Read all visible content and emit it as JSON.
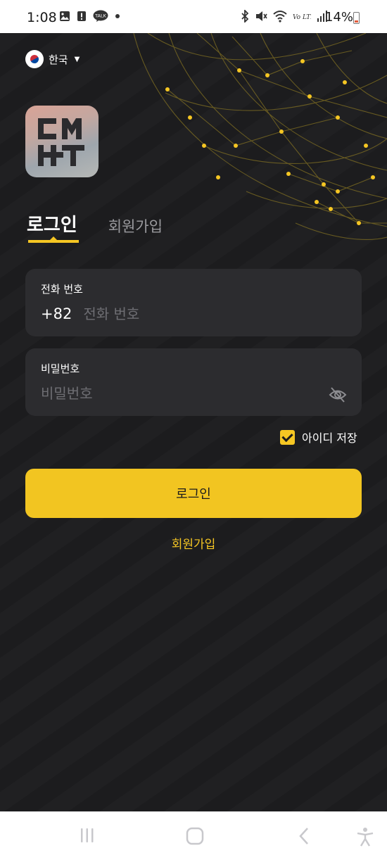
{
  "status_bar": {
    "time": "1:08",
    "battery": "14%",
    "notification_icons": [
      "image-icon",
      "alert-icon",
      "talk-icon",
      "dot-icon"
    ],
    "system_icons": [
      "bluetooth-icon",
      "mute-icon",
      "wifi-icon",
      "volte-icon",
      "signal-icon",
      "battery-icon"
    ],
    "talk_badge": "TALK",
    "volte_label": "Vo LTE"
  },
  "language": {
    "label": "한국",
    "icon": "korea-flag-icon"
  },
  "logo": {
    "text": "CMHT"
  },
  "tabs": [
    {
      "label": "로그인",
      "active": true
    },
    {
      "label": "회원가입",
      "active": false
    }
  ],
  "phone_field": {
    "label": "전화 번호",
    "prefix": "+82",
    "placeholder": "전화 번호",
    "value": ""
  },
  "password_field": {
    "label": "비밀번호",
    "placeholder": "비밀번호",
    "value": "",
    "icon": "eye-off-icon"
  },
  "remember": {
    "label": "아이디 저장",
    "checked": true
  },
  "login_button": {
    "label": "로그인"
  },
  "signup_link": {
    "label": "회원가입"
  },
  "nav_bar": {
    "icons": [
      "recents-icon",
      "home-icon",
      "back-icon",
      "accessibility-icon"
    ]
  },
  "colors": {
    "accent": "#f5c623",
    "background": "#1c1c1e",
    "field": "#2c2c2f"
  }
}
